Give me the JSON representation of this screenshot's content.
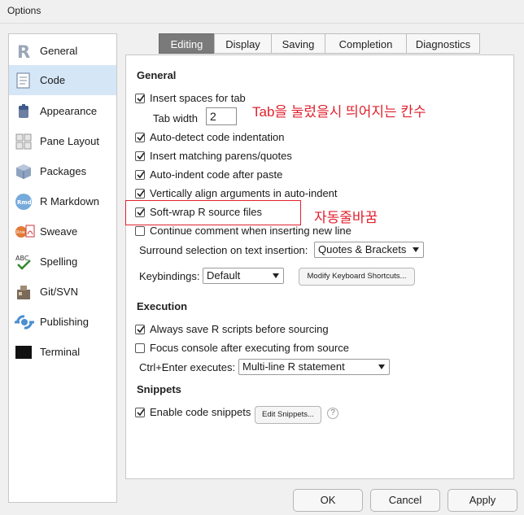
{
  "window": {
    "title": "Options"
  },
  "sidebar": {
    "items": [
      {
        "label": "General",
        "icon": "r-logo-icon",
        "active": false
      },
      {
        "label": "Code",
        "icon": "code-document-icon",
        "active": true
      },
      {
        "label": "Appearance",
        "icon": "paint-bucket-icon",
        "active": false
      },
      {
        "label": "Pane Layout",
        "icon": "pane-grid-icon",
        "active": false
      },
      {
        "label": "Packages",
        "icon": "package-box-icon",
        "active": false
      },
      {
        "label": "R Markdown",
        "icon": "rmd-icon",
        "active": false
      },
      {
        "label": "Sweave",
        "icon": "sweave-pdf-icon",
        "active": false
      },
      {
        "label": "Spelling",
        "icon": "abc-check-icon",
        "active": false
      },
      {
        "label": "Git/SVN",
        "icon": "git-icon",
        "active": false
      },
      {
        "label": "Publishing",
        "icon": "publish-icon",
        "active": false
      },
      {
        "label": "Terminal",
        "icon": "terminal-icon",
        "active": false
      }
    ]
  },
  "tabs": [
    {
      "label": "Editing",
      "active": true
    },
    {
      "label": "Display",
      "active": false
    },
    {
      "label": "Saving",
      "active": false
    },
    {
      "label": "Completion",
      "active": false
    },
    {
      "label": "Diagnostics",
      "active": false
    }
  ],
  "general": {
    "heading": "General",
    "insert_spaces": {
      "label": "Insert spaces for tab",
      "checked": true
    },
    "tab_width_label": "Tab width",
    "tab_width_value": "2",
    "options": [
      {
        "label": "Auto-detect code indentation",
        "checked": true
      },
      {
        "label": "Insert matching parens/quotes",
        "checked": true
      },
      {
        "label": "Auto-indent code after paste",
        "checked": true
      },
      {
        "label": "Vertically align arguments in auto-indent",
        "checked": true
      },
      {
        "label": "Soft-wrap R source files",
        "checked": true
      },
      {
        "label": "Continue comment when inserting new line",
        "checked": false
      }
    ],
    "surround_label": "Surround selection on text insertion:",
    "surround_value": "Quotes & Brackets",
    "keybindings_label": "Keybindings:",
    "keybindings_value": "Default",
    "modify_shortcuts_label": "Modify Keyboard Shortcuts..."
  },
  "execution": {
    "heading": "Execution",
    "always_save": {
      "label": "Always save R scripts before sourcing",
      "checked": true
    },
    "focus_console": {
      "label": "Focus console after executing from source",
      "checked": false
    },
    "ctrl_enter_label": "Ctrl+Enter executes:",
    "ctrl_enter_value": "Multi-line R statement"
  },
  "snippets": {
    "heading": "Snippets",
    "enable": {
      "label": "Enable code snippets",
      "checked": true
    },
    "edit_label": "Edit Snippets...",
    "help_glyph": "?"
  },
  "annotations": {
    "tab_note": "Tab을 눌렀을시 띄어지는 칸수",
    "wrap_note": "자동줄바꿈",
    "color": "#e0212e"
  },
  "footer": {
    "ok": "OK",
    "cancel": "Cancel",
    "apply": "Apply"
  }
}
